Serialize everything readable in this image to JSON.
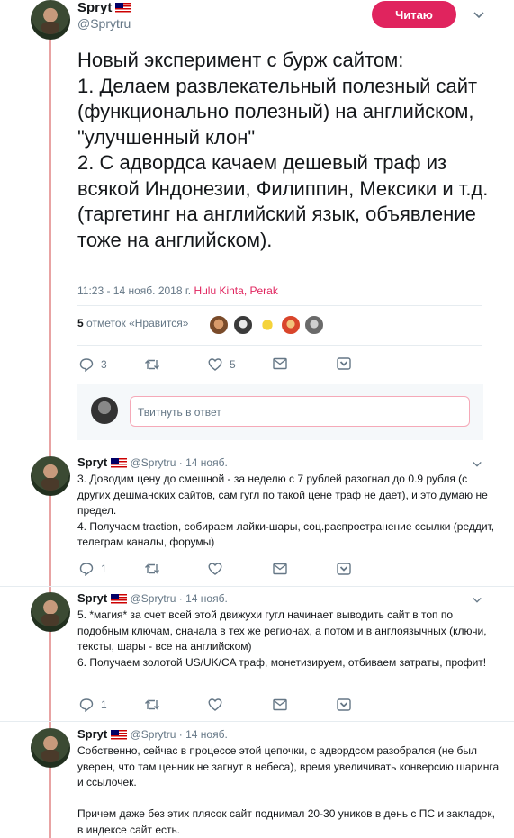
{
  "header": {
    "name": "Spryt",
    "handle": "@Sprytru",
    "follow_label": "Читаю"
  },
  "main_tweet": {
    "text": "Новый эксперимент с бурж сайтом:\n1. Делаем развлекательный полезный сайт (функционально полезный) на английском, \"улучшенный клон\"\n2. С адвордса качаем дешевый траф из всякой Индонезии, Филиппин, Мексики и т.д. (таргетинг на английский язык, объявление тоже на английском).",
    "timestamp": "11:23 - 14 нояб. 2018 г.",
    "location": "Hulu Kinta, Perak",
    "likes_count": "5",
    "likes_label": "отметок «Нравится»",
    "replies": "3",
    "retweets": "",
    "likes": "5"
  },
  "reply_box": {
    "placeholder": "Твитнуть в ответ"
  },
  "replies": [
    {
      "name": "Spryt",
      "handle": "@Sprytru",
      "date": "14 нояб.",
      "text": "3. Доводим цену до смешной - за неделю с 7 рублей разогнал до 0.9 рубля (с других дешманских сайтов, сам гугл по такой цене траф не дает), и это думаю не предел.\n4. Получаем traction, собираем лайки-шары, соц.распространение ссылки (реддит, телеграм каналы, форумы)",
      "reply_count": "1"
    },
    {
      "name": "Spryt",
      "handle": "@Sprytru",
      "date": "14 нояб.",
      "text": "5. *магия* за счет всей этой движухи гугл начинает выводить сайт в топ по подобным ключам, сначала в тех же регионах, а потом и в англоязычных (ключи, тексты, шары - все на английском)\n6. Получаем золотой US/UK/CA траф, монетизируем, отбиваем затраты, профит!",
      "reply_count": "1"
    },
    {
      "name": "Spryt",
      "handle": "@Sprytru",
      "date": "14 нояб.",
      "text": "Собственно, сейчас в процессе этой цепочки, с адвордсом разобрался (не был уверен, что там ценник не загнут в небеса), время увеличивать конверсию шаринга и ссылочек.\n\nПричем даже без этих плясок сайт поднимал 20-30 уников в день с ПС и закладок, в индексе сайт есть.",
      "reply_count": ""
    }
  ],
  "colors": {
    "accent": "#e0245e",
    "thread_line": "#e8a3a3",
    "secondary_text": "#657786"
  }
}
